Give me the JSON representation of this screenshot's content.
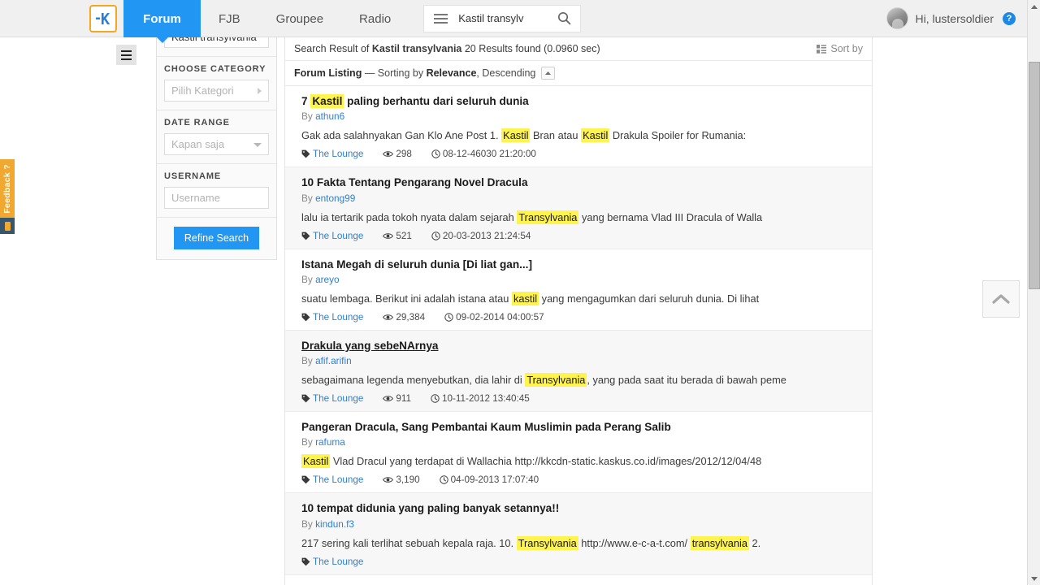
{
  "nav": {
    "logo_text": "-K",
    "logo_icon": "kaskus-logo-icon",
    "items": [
      {
        "label": "Forum",
        "active": true
      },
      {
        "label": "FJB",
        "active": false
      },
      {
        "label": "Groupee",
        "active": false
      },
      {
        "label": "Radio",
        "active": false
      }
    ],
    "burger_icon": "hamburger-menu-icon",
    "search_value": "Kastil transylv",
    "search_placeholder": "Kastil transylv",
    "search_icon": "search-icon",
    "user_greeting": "Hi, lustersoldier",
    "help_badge": "?",
    "avatar_icon": "user-avatar"
  },
  "sidebar": {
    "toggle_icon": "sidebar-toggle-icon",
    "keyword_value": "Kastil transylvania",
    "sections": [
      {
        "label": "CHOOSE CATEGORY",
        "control": "select",
        "value": "Pilih Kategori",
        "caret": "chevron-right-icon"
      },
      {
        "label": "DATE RANGE",
        "control": "select",
        "value": "Kapan saja",
        "caret": "chevron-down-icon"
      },
      {
        "label": "USERNAME",
        "control": "input",
        "value": "",
        "placeholder": "Username"
      }
    ],
    "refine_label": "Refine Search"
  },
  "results_header": {
    "prefix": "Search Result of",
    "query": "Kastil transylvania",
    "suffix": "20 Results found (0.0960 sec)",
    "sort_by_label": "Sort by",
    "sort_by_icon": "sort-list-icon"
  },
  "listing_header": {
    "title": "Forum Listing",
    "dash": "—",
    "sorting_prefix": "Sorting by",
    "sorting_field": "Relevance",
    "sorting_dir": ", Descending",
    "dir_icon": "caret-up-icon"
  },
  "results": [
    {
      "title_parts": [
        {
          "t": "7 ",
          "hl": false
        },
        {
          "t": "Kastil",
          "hl": true
        },
        {
          "t": " paling berhantu dari seluruh dunia",
          "hl": false
        }
      ],
      "title_plain": "7 Kastil paling berhantu dari seluruh dunia",
      "by_label": "By",
      "author": "athun6",
      "underline": false,
      "snippet_parts": [
        {
          "t": "Gak ada salahnyakan Gan Klo Ane Post 1. ",
          "hl": false
        },
        {
          "t": "Kastil",
          "hl": true
        },
        {
          "t": " Bran atau ",
          "hl": false
        },
        {
          "t": "Kastil",
          "hl": true
        },
        {
          "t": " Drakula Spoiler for Rumania:",
          "hl": false
        }
      ],
      "category": "The Lounge",
      "views": "298",
      "date": "08-12-46030 21:20:00"
    },
    {
      "title_parts": [
        {
          "t": "10 Fakta Tentang Pengarang Novel Dracula",
          "hl": false
        }
      ],
      "title_plain": "10 Fakta Tentang Pengarang Novel Dracula",
      "by_label": "By",
      "author": "entong99",
      "underline": false,
      "snippet_parts": [
        {
          "t": "lalu ia tertarik pada tokoh nyata dalam sejarah ",
          "hl": false
        },
        {
          "t": "Transylvania",
          "hl": true
        },
        {
          "t": " yang bernama Vlad III Dracula of Walla",
          "hl": false
        }
      ],
      "category": "The Lounge",
      "views": "521",
      "date": "20-03-2013 21:24:54"
    },
    {
      "title_parts": [
        {
          "t": "Istana Megah di seluruh dunia [Di liat gan...]",
          "hl": false
        }
      ],
      "title_plain": "Istana Megah di seluruh dunia [Di liat gan...]",
      "by_label": "By",
      "author": "areyo",
      "underline": false,
      "snippet_parts": [
        {
          "t": "suatu lembaga. Berikut ini adalah istana atau ",
          "hl": false
        },
        {
          "t": "kastil",
          "hl": true
        },
        {
          "t": " yang mengagumkan dari seluruh dunia. Di lihat",
          "hl": false
        }
      ],
      "category": "The Lounge",
      "views": "29,384",
      "date": "09-02-2014 04:00:57"
    },
    {
      "title_parts": [
        {
          "t": "Drakula yang sebeNArnya",
          "hl": false
        }
      ],
      "title_plain": "Drakula yang sebeNArnya",
      "by_label": "By",
      "author": "afif.arifin",
      "underline": true,
      "snippet_parts": [
        {
          "t": "sebagaimana legenda menyebutkan, dia lahir di ",
          "hl": false
        },
        {
          "t": "Transylvania",
          "hl": true
        },
        {
          "t": ", yang pada saat itu berada di bawah peme",
          "hl": false
        }
      ],
      "category": "The Lounge",
      "views": "911",
      "date": "10-11-2012 13:40:45"
    },
    {
      "title_parts": [
        {
          "t": "Pangeran Dracula, Sang Pembantai Kaum Muslimin pada Perang Salib",
          "hl": false
        }
      ],
      "title_plain": "Pangeran Dracula, Sang Pembantai Kaum Muslimin pada Perang Salib",
      "by_label": "By",
      "author": "rafuma",
      "underline": false,
      "snippet_parts": [
        {
          "t": "Kastil",
          "hl": true
        },
        {
          "t": " Vlad Dracul yang terdapat di Wallachia http://kkcdn-static.kaskus.co.id/images/2012/12/04/48",
          "hl": false
        }
      ],
      "category": "The Lounge",
      "views": "3,190",
      "date": "04-09-2013 17:07:40"
    },
    {
      "title_parts": [
        {
          "t": "10 tempat didunia yang paling banyak setannya!!",
          "hl": false
        }
      ],
      "title_plain": "10 tempat didunia yang paling banyak setannya!!",
      "by_label": "By",
      "author": "kindun.f3",
      "underline": false,
      "snippet_parts": [
        {
          "t": "217 sering kali terlihat sebuah kepala raja. 10. ",
          "hl": false
        },
        {
          "t": "Transylvania",
          "hl": true
        },
        {
          "t": " http://www.e-c-a-t.com/ ",
          "hl": false
        },
        {
          "t": "transylvania",
          "hl": true
        },
        {
          "t": " 2.",
          "hl": false
        }
      ],
      "category": "The Lounge",
      "views": "",
      "date": ""
    }
  ],
  "meta_icons": {
    "category_icon": "tag-icon",
    "views_icon": "eye-icon",
    "date_icon": "clock-icon"
  },
  "feedback": {
    "label": "Feedback ?",
    "icon": "feedback-icon"
  },
  "scroll_top": {
    "icon": "chevron-up-icon"
  },
  "scrollbar": {
    "up_icon": "scroll-up-arrow-icon",
    "down_icon": "scroll-down-arrow-icon",
    "thumb": "scrollbar-thumb"
  },
  "colors": {
    "brand_blue": "#2196f3",
    "highlight_yellow": "#fff34d",
    "link_blue": "#2f7fd0",
    "feedback_orange": "#f0a830",
    "logo_border": "#f5a623"
  }
}
